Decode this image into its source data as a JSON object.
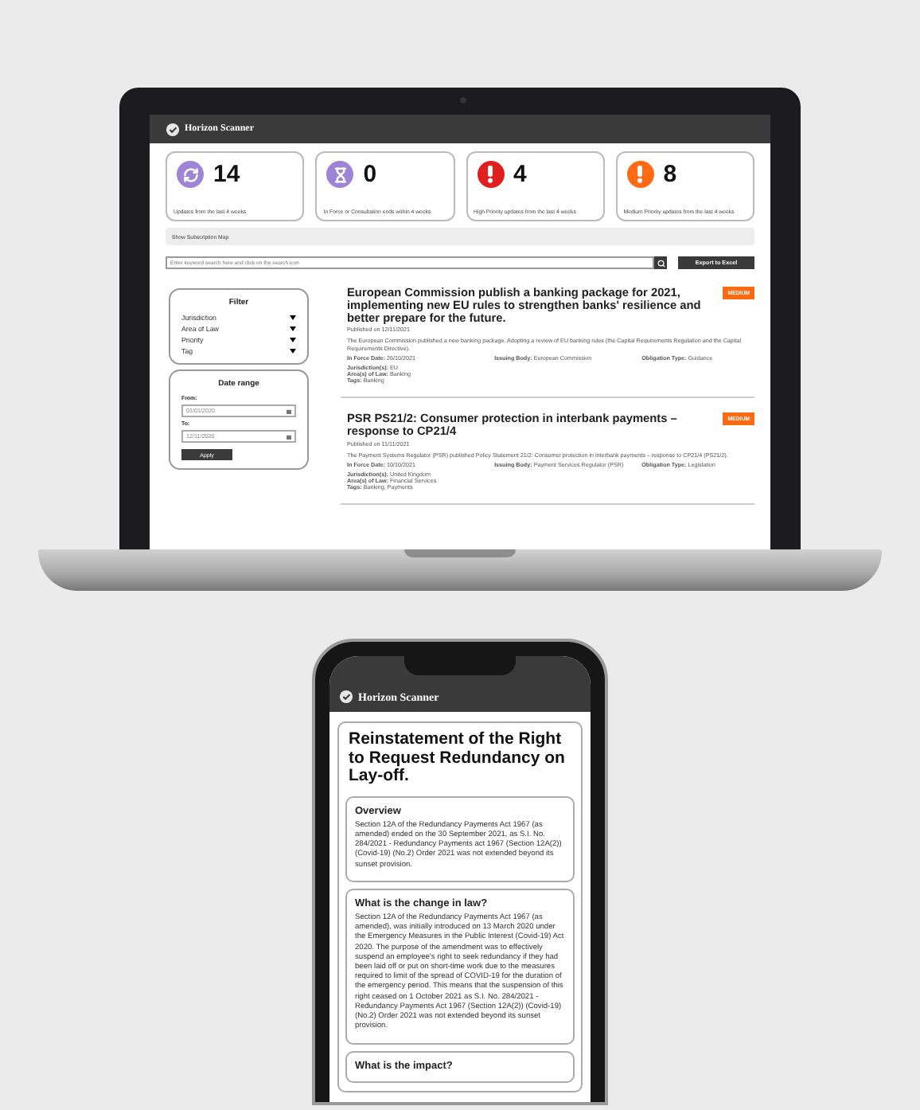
{
  "laptop": {
    "app_name": "Horizon Scanner",
    "stats": [
      {
        "kind": "refresh",
        "value": "14",
        "label": "Updates from the last 4 weeks",
        "color": "#9d84d6"
      },
      {
        "kind": "hourglass",
        "value": "0",
        "label": "In Force or Consultation ends within 4 weeks",
        "color": "#9d84d6"
      },
      {
        "kind": "alert",
        "value": "4",
        "label": "High Priority updates from the last 4 weeks",
        "color": "#e01f1f"
      },
      {
        "kind": "alert",
        "value": "8",
        "label": "Medium Priority updates from the last 4 weeks",
        "color": "#ff6a13"
      }
    ],
    "map_toggle": "Show Subscription Map",
    "search": {
      "placeholder": "Enter keyword search here and click on the search icon"
    },
    "export_button": "Export to Excel",
    "filter": {
      "title": "Filter",
      "options": [
        "Jurisdiction",
        "Area of Law",
        "Priority",
        "Tag"
      ]
    },
    "date_range": {
      "title": "Date range",
      "from_label": "From:",
      "from_value": "01/01/2020",
      "to_label": "To:",
      "to_value": "12/11/2020",
      "button": "Apply"
    },
    "articles": [
      {
        "title": "European Commission publish a banking package for 2021, implementing new EU rules to strengthen banks' resilience and better prepare for the future.",
        "badge": "MEDIUM",
        "published": "Published on 12/11/2021",
        "summary": "The European Commission published a new banking package. Adopting a review of EU banking rules (the Capital Requirements Regulation and the Capital Requirements Directive).",
        "fields": [
          {
            "label": "In Force Date:",
            "value": "26/10/2021"
          },
          {
            "label": "Issuing Body:",
            "value": "European Commission"
          },
          {
            "label": "Obligation Type:",
            "value": "Guidance"
          }
        ],
        "meta": [
          {
            "label": "Jurisdiction(s):",
            "value": "EU"
          },
          {
            "label": "Area(s) of Law:",
            "value": "Banking"
          },
          {
            "label": "Tags:",
            "value": "Banking"
          }
        ]
      },
      {
        "title": "PSR PS21/2: Consumer protection in interbank payments – response to CP21/4",
        "badge": "MEDIUM",
        "published": "Published on 11/11/2021",
        "summary": "The Payment Systems Regulator (PSR) published Policy Statement 21/2: Consumer protection in interbank payments – response to CP21/4 (PS21/2).",
        "fields": [
          {
            "label": "In Force Date:",
            "value": "10/10/2021"
          },
          {
            "label": "Issuing Body:",
            "value": "Payment Services Regulator (PSR)"
          },
          {
            "label": "Obligation Type:",
            "value": "Legislation"
          }
        ],
        "meta": [
          {
            "label": "Jurisdiction(s):",
            "value": "United Kingdom"
          },
          {
            "label": "Area(s) of Law:",
            "value": "Financial Services"
          },
          {
            "label": "Tags:",
            "value": "Banking, Payments"
          }
        ]
      }
    ]
  },
  "phone": {
    "app_name": "Horizon Scanner",
    "title": "Reinstatement of the Right to Request Redundancy on Lay-off.",
    "sections": [
      {
        "heading": "Overview",
        "body": "Section 12A of the Redundancy Payments Act 1967 (as amended) ended on the 30 September 2021, as S.I. No. 284/2021 - Redundancy Payments act 1967 (Section 12A(2)) (Covid-19) (No.2) Order 2021 was not extended beyond its sunset provision."
      },
      {
        "heading": "What is the change in law?",
        "body": "Section 12A of the Redundancy Payments Act 1967 (as amended), was initially introduced on 13 March 2020 under the Emergency Measures in the Public Interest (Covid-19) Act 2020. The purpose of the amendment was to effectively suspend an employee's right to seek redundancy if they had been laid off or put on short-time work due to the measures required to limit of the spread of COVID-19 for the duration of the emergency period. This means that the suspension of this right ceased on 1 October 2021 as S.I. No. 284/2021 - Redundancy Payments Act 1967 (Section 12A(2)) (Covid-19) (No.2) Order 2021 was not extended beyond its sunset provision."
      },
      {
        "heading": "What is the impact?"
      }
    ]
  }
}
